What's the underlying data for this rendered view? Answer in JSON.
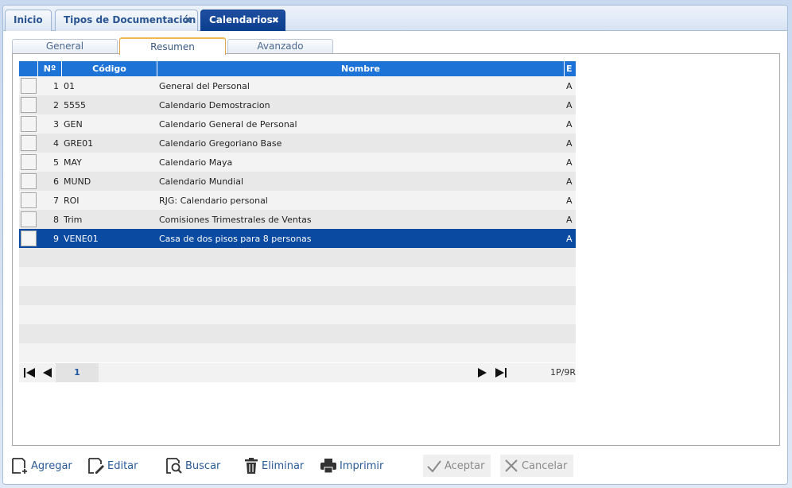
{
  "top_tabs": [
    {
      "label": "Inicio"
    },
    {
      "label": "Tipos de Documentación"
    },
    {
      "label": "Calendarios"
    }
  ],
  "sub_tabs": [
    {
      "label": "General"
    },
    {
      "label": "Resumen"
    },
    {
      "label": "Avanzado"
    }
  ],
  "grid": {
    "headers": {
      "num": "Nº",
      "codigo": "Código",
      "nombre": "Nombre",
      "e": "E"
    },
    "rows": [
      {
        "num": "1",
        "codigo": "01",
        "nombre": "General del Personal",
        "e": "A"
      },
      {
        "num": "2",
        "codigo": "5555",
        "nombre": "Calendario Demostracion",
        "e": "A"
      },
      {
        "num": "3",
        "codigo": "GEN",
        "nombre": "Calendario General de Personal",
        "e": "A"
      },
      {
        "num": "4",
        "codigo": "GRE01",
        "nombre": "Calendario Gregoriano Base",
        "e": "A"
      },
      {
        "num": "5",
        "codigo": "MAY",
        "nombre": "Calendario Maya",
        "e": "A"
      },
      {
        "num": "6",
        "codigo": "MUND",
        "nombre": "Calendario Mundial",
        "e": "A"
      },
      {
        "num": "7",
        "codigo": "ROI",
        "nombre": "RJG: Calendario personal",
        "e": "A"
      },
      {
        "num": "8",
        "codigo": "Trim",
        "nombre": "Comisiones Trimestrales de Ventas",
        "e": "A"
      },
      {
        "num": "9",
        "codigo": "VENE01",
        "nombre": "Casa de dos pisos para 8 personas",
        "e": "A"
      }
    ]
  },
  "pager": {
    "page": "1",
    "info": "1P/9R"
  },
  "toolbar": {
    "agregar": "Agregar",
    "editar": "Editar",
    "buscar": "Buscar",
    "eliminar": "Eliminar",
    "imprimir": "Imprimir",
    "aceptar": "Aceptar",
    "cancelar": "Cancelar"
  }
}
